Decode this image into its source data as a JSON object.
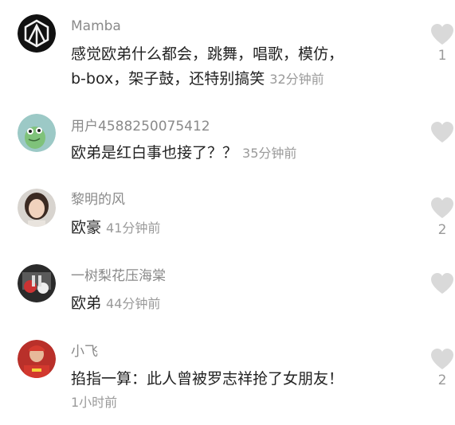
{
  "comments": [
    {
      "avatar_icon": "linkin-park-logo-avatar",
      "name": "Mamba",
      "text": "感觉欧弟什么都会，跳舞，唱歌，模仿，\nb-box，架子鼓，还特别搞笑",
      "time": "32分钟前",
      "likes": "1"
    },
    {
      "avatar_icon": "green-cartoon-avatar",
      "name": "用户4588250075412",
      "text": "欧弟是红白事也接了？？",
      "time": "35分钟前",
      "likes": ""
    },
    {
      "avatar_icon": "girl-portrait-avatar",
      "name": "黎明的风",
      "text": "欧豪",
      "time": "41分钟前",
      "likes": "2"
    },
    {
      "avatar_icon": "dark-photo-avatar",
      "name": "一树梨花压海棠",
      "text": "欧弟",
      "time": "44分钟前",
      "likes": ""
    },
    {
      "avatar_icon": "red-jersey-avatar",
      "name": "小飞",
      "text": "掐指一算：此人曾被罗志祥抢了女朋友！",
      "time": "1小时前",
      "likes": "2"
    }
  ],
  "colors": {
    "heart": "#d9d9d9",
    "name": "#8a8a8a",
    "text": "#222222",
    "time": "#9a9a9a"
  }
}
